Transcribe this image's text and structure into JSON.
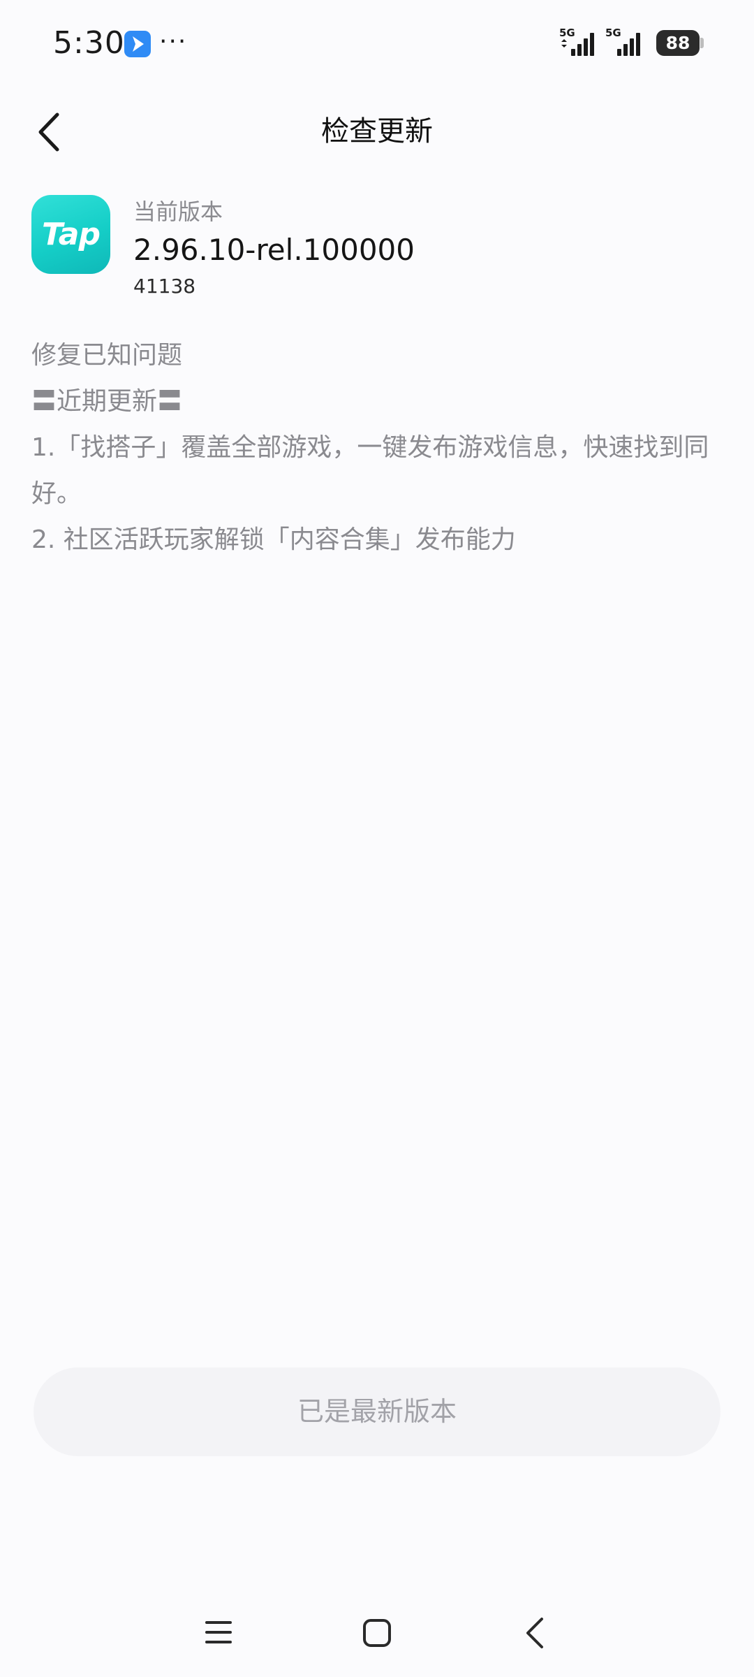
{
  "status_bar": {
    "time": "5:30",
    "more": "···",
    "network_1": "5G",
    "network_2": "5G",
    "battery": "88"
  },
  "header": {
    "title": "检查更新"
  },
  "app": {
    "logo_text": "Tap",
    "version_label": "当前版本",
    "version": "2.96.10-rel.100000",
    "build": "41138"
  },
  "changelog": {
    "lines": [
      "修复已知问题",
      "〓近期更新〓",
      "1.「找搭子」覆盖全部游戏，一键发布游戏信息，快速找到同好。",
      "2. 社区活跃玩家解锁「内容合集」发布能力"
    ]
  },
  "status_button": {
    "label": "已是最新版本"
  },
  "colors": {
    "background": "#fbfbfd",
    "accent": "#15cec7",
    "secondary_text": "#8a8a8f"
  },
  "icons": {
    "back": "chevron-left-icon",
    "nav_menu": "menu-icon",
    "nav_home": "home-square-icon",
    "nav_back": "nav-back-icon"
  }
}
